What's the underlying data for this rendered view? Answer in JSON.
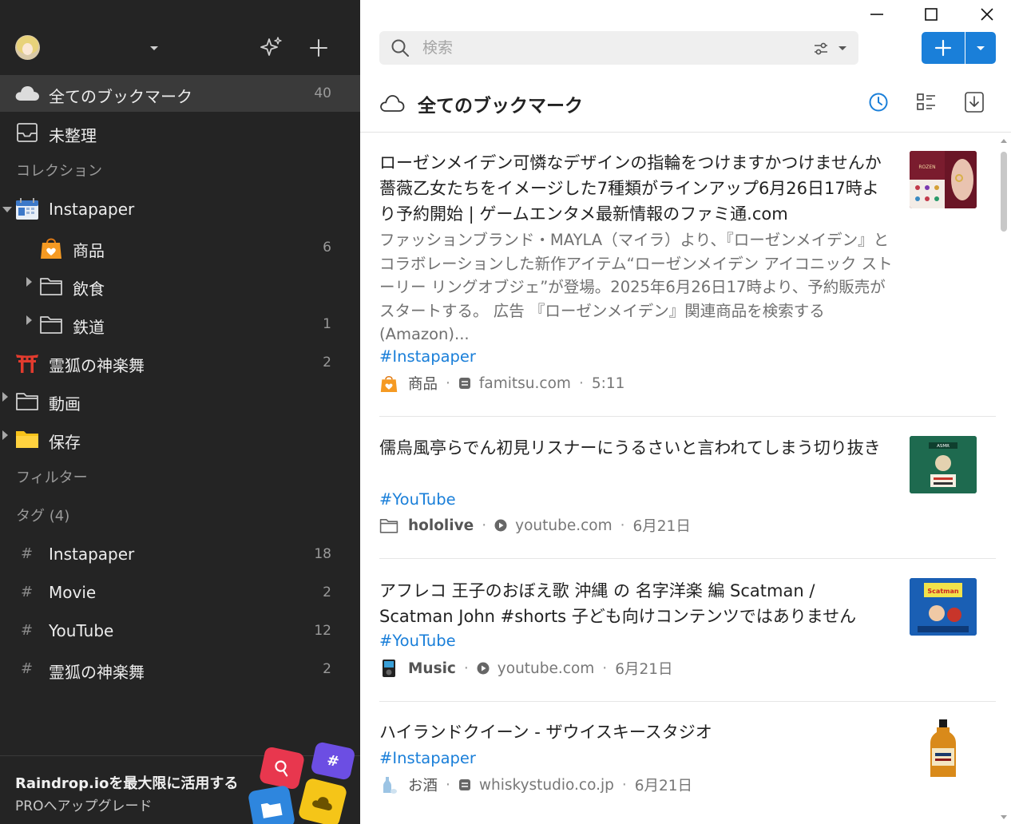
{
  "sidebar": {
    "all_bookmarks": {
      "label": "全てのブックマーク",
      "count": "40"
    },
    "unsorted": {
      "label": "未整理"
    },
    "collections_heading": "コレクション",
    "collections": [
      {
        "label": "Instapaper",
        "count": "",
        "icon": "calendar-icon"
      },
      {
        "label": "商品",
        "count": "6",
        "icon": "shopping-bag-icon"
      },
      {
        "label": "飲食",
        "count": "",
        "icon": "folder-icon"
      },
      {
        "label": "鉄道",
        "count": "1",
        "icon": "folder-icon"
      },
      {
        "label": "霊狐の神楽舞",
        "count": "2",
        "icon": "torii-icon"
      },
      {
        "label": "動画",
        "count": "",
        "icon": "folder-icon"
      },
      {
        "label": "保存",
        "count": "",
        "icon": "folder-icon"
      }
    ],
    "filters_heading": "フィルター",
    "tags_heading": "タグ (4)",
    "tags": [
      {
        "label": "Instapaper",
        "count": "18"
      },
      {
        "label": "Movie",
        "count": "2"
      },
      {
        "label": "YouTube",
        "count": "12"
      },
      {
        "label": "霊狐の神楽舞",
        "count": "2"
      }
    ],
    "promo": {
      "title": "Raindrop.ioを最大限に活用する",
      "subtitle": "PROへアップグレード"
    }
  },
  "search": {
    "placeholder": "検索"
  },
  "header": {
    "title": "全てのブックマーク"
  },
  "colors": {
    "accent": "#1a7fd9",
    "sidebar_bg": "#242424",
    "sidebar_active": "#3a3a3a"
  },
  "bookmarks": [
    {
      "title": "ローゼンメイデン可憐なデザインの指輪をつけますかつけませんか薔薇乙女たちをイメージした7種類がラインアップ6月26日17時より予約開始 | ゲームエンタメ最新情報のファミ通.com",
      "excerpt": "ファッションブランド・MAYLA（マイラ）より、『ローゼンメイデン』とコラボレーションした新作アイテム“ローゼンメイデン アイコニック ストーリー リングオブジェ”が登場。2025年6月26日17時より、予約販売がスタートする。 広告 『ローゼンメイデン』関連商品を検索する(Amazon)...",
      "tag": "#Instapaper",
      "collection": "商品",
      "domain": "famitsu.com",
      "time": "5:11",
      "collection_icon": "shopping-bag-icon",
      "domain_icon": "article-icon"
    },
    {
      "title": "儒烏風亭らでん初見リスナーにうるさいと言われてしまう切り抜き",
      "excerpt": "",
      "tag": "#YouTube",
      "collection": "hololive",
      "domain": "youtube.com",
      "time": "6月21日",
      "collection_icon": "folder-icon",
      "domain_icon": "video-icon"
    },
    {
      "title": "アフレコ 王子のおぼえ歌 沖縄 の 名字洋楽 編 Scatman / Scatman John #shorts 子ども向けコンテンツではありません",
      "excerpt": "",
      "tag": "#YouTube",
      "collection": "Music",
      "domain": "youtube.com",
      "time": "6月21日",
      "collection_icon": "music-player-icon",
      "domain_icon": "video-icon"
    },
    {
      "title": "ハイランドクイーン - ザウイスキースタジオ",
      "excerpt": "",
      "tag": "#Instapaper",
      "collection": "お酒",
      "domain": "whiskystudio.co.jp",
      "time": "6月21日",
      "collection_icon": "sake-icon",
      "domain_icon": "article-icon"
    }
  ]
}
